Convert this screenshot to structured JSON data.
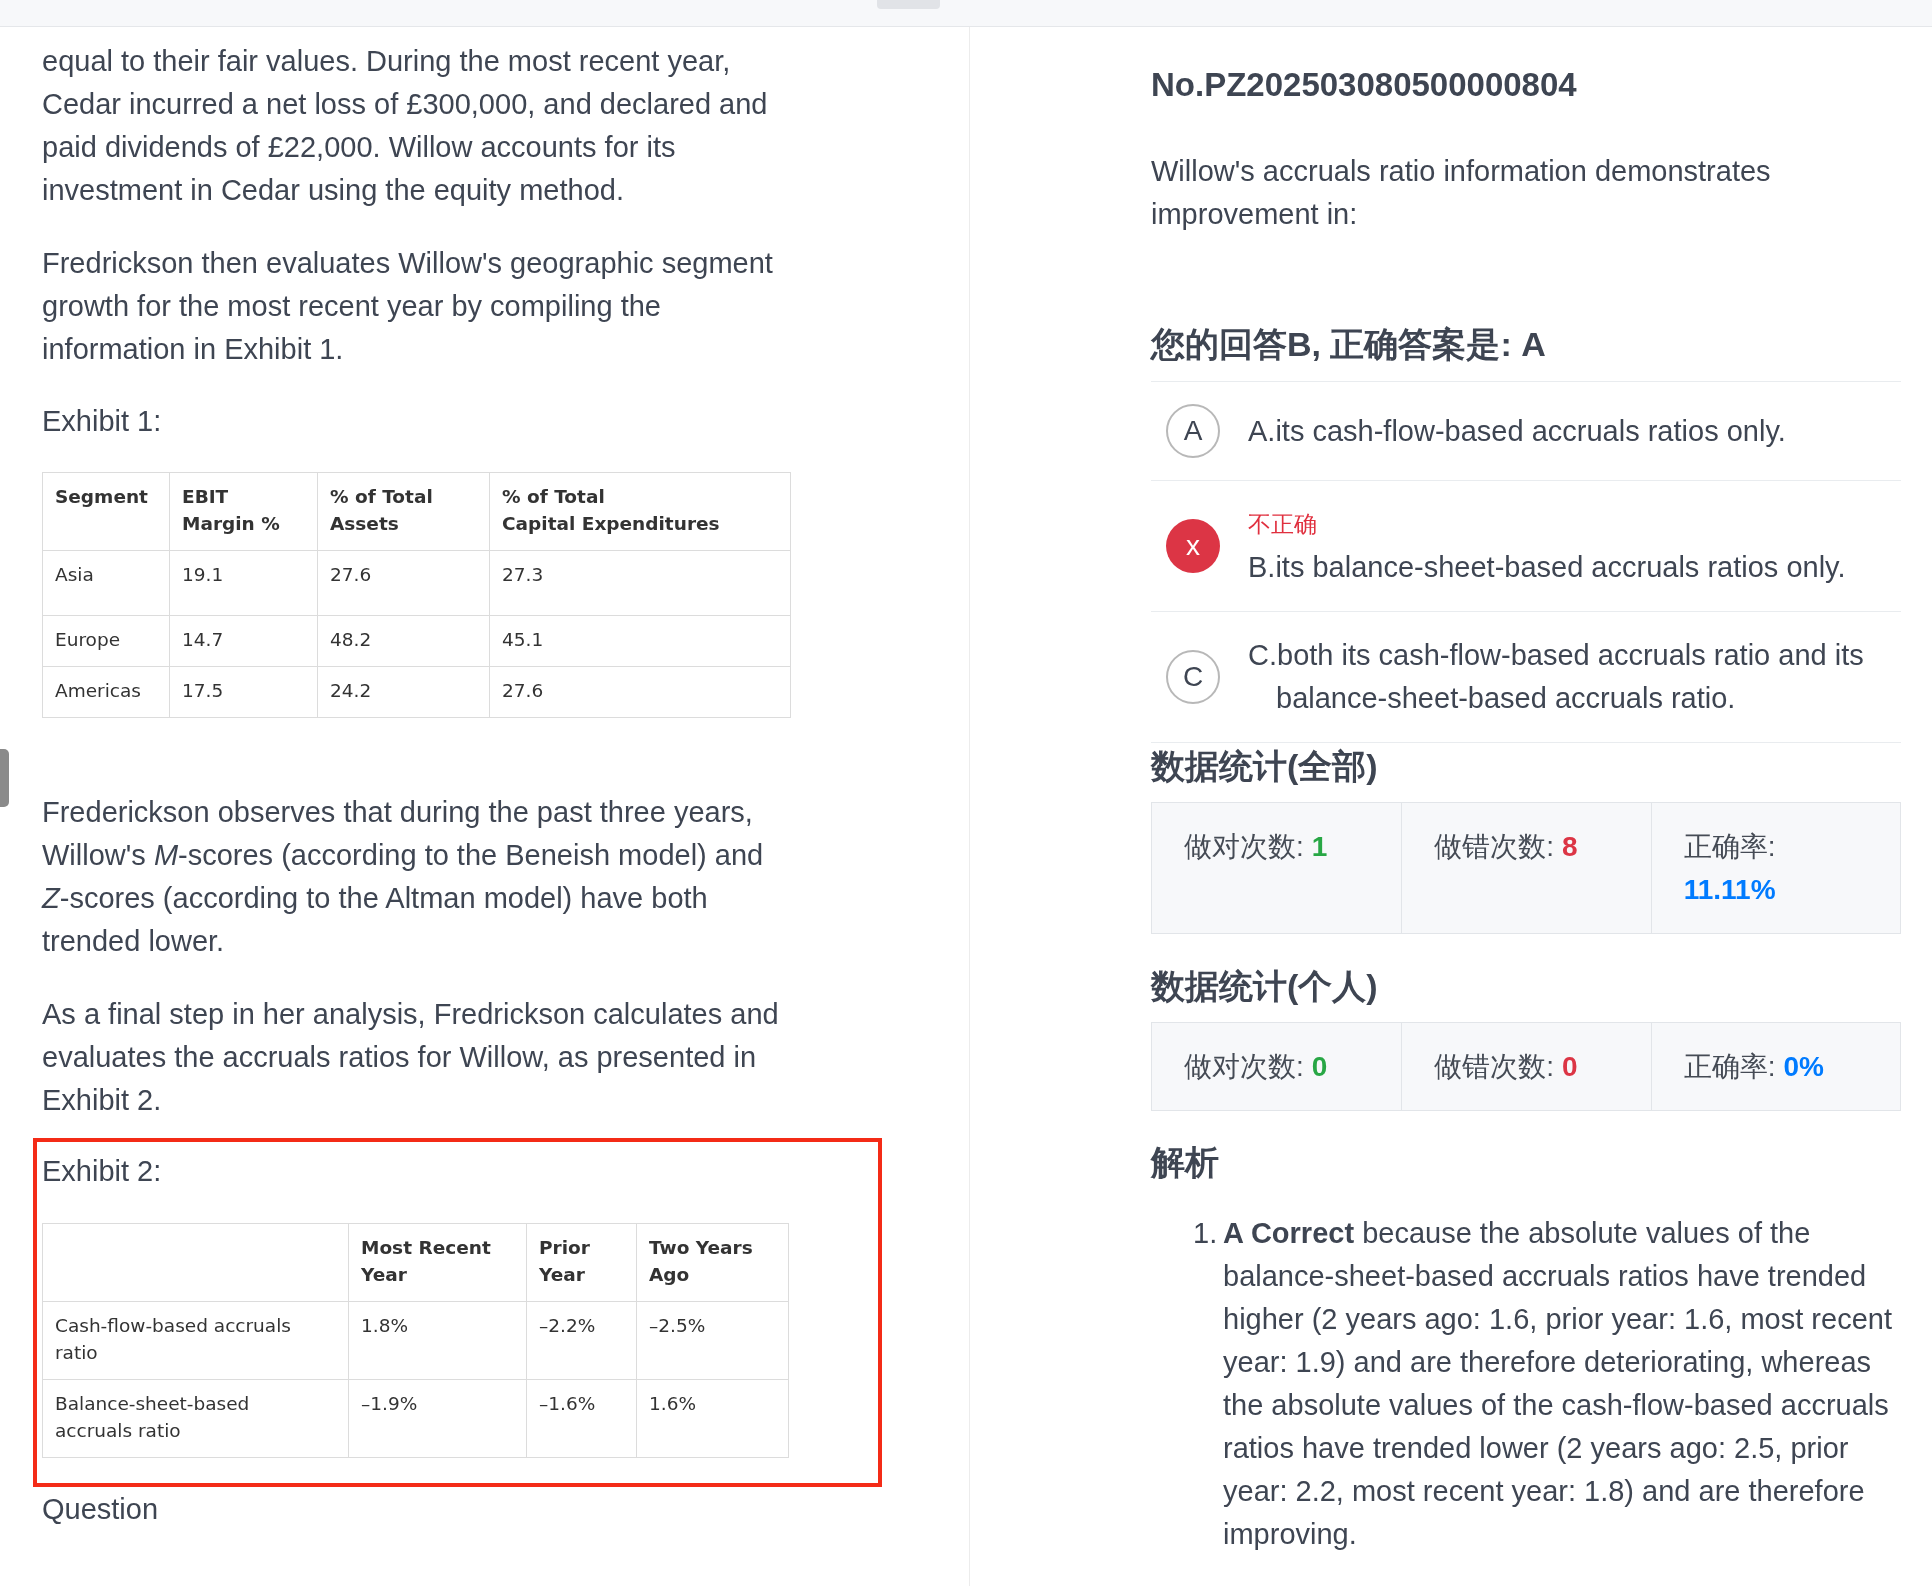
{
  "passage": {
    "blocks": [
      {
        "kind": "paragraph",
        "text": "equal to their fair values. During the most recent year, Cedar incurred a net loss of £300,000, and declared and paid dividends of £22,000. Willow accounts for its investment in Cedar using the equity method."
      },
      {
        "kind": "paragraph",
        "text": "Fredrickson then evaluates Willow's geographic segment growth for the most recent year by compiling the information in Exhibit 1."
      },
      {
        "kind": "caption",
        "text": "Exhibit 1:"
      },
      {
        "kind": "table",
        "corner": "Segment",
        "columns": [
          "EBIT\nMargin %",
          "% of Total\nAssets",
          "% of Total\nCapital Expenditures"
        ],
        "rows": [
          {
            "label": "Asia",
            "values": [
              "19.1",
              "27.6",
              "27.3"
            ]
          },
          {
            "label": "Europe",
            "values": [
              "14.7",
              "48.2",
              "45.1"
            ]
          },
          {
            "label": "Americas",
            "values": [
              "17.5",
              "24.2",
              "27.6"
            ]
          }
        ]
      },
      {
        "kind": "paragraph",
        "text": "Frederickson observes that during the past three years, Willow's *M*-scores (according to the Beneish model) and *Z*-scores (according to the Altman model) have both trended lower."
      },
      {
        "kind": "paragraph",
        "text": "As a final step in her analysis, Fredrickson calculates and evaluates the accruals ratios for Willow, as presented in Exhibit 2."
      },
      {
        "kind": "highlight",
        "blocks": [
          {
            "kind": "caption",
            "text": "Exhibit 2:"
          },
          {
            "kind": "table",
            "columns": [
              "Most Recent\nYear",
              "Prior\nYear",
              "Two Years\nAgo"
            ],
            "rows": [
              {
                "label": "Cash-flow-based accruals\nratio",
                "values": [
                  "1.8%",
                  "–2.2%",
                  "–2.5%"
                ]
              },
              {
                "label": "Balance-sheet-based\naccruals ratio",
                "values": [
                  "–1.9%",
                  "–1.6%",
                  "1.6%"
                ]
              }
            ]
          }
        ]
      },
      {
        "kind": "label",
        "text": "Question"
      }
    ]
  },
  "question": {
    "number": "No.PZ202503080500000804",
    "text": "Willow's accruals ratio information demonstrates improvement in:"
  },
  "result": {
    "heading": "您的回答B, 正确答案是: A",
    "options": [
      {
        "marker": "A",
        "text": "A.its cash-flow-based accruals ratios only.",
        "selected": false
      },
      {
        "marker": "x",
        "note": "不正确",
        "text": "B.its balance-sheet-based accruals ratios only.",
        "selected": true
      },
      {
        "marker": "C",
        "text": "C.both its cash-flow-based accruals ratio and its balance-sheet-based accruals ratio.",
        "selected": false
      }
    ]
  },
  "stats": [
    {
      "title": "数据统计(全部)",
      "cells": [
        {
          "label": "做对次数:",
          "value": "1",
          "color": "#28a745"
        },
        {
          "label": "做错次数:",
          "value": "8",
          "color": "#dc3545"
        },
        {
          "label": "正确率:",
          "value": "11.11%",
          "color": "#007bff"
        }
      ]
    },
    {
      "title": "数据统计(个人)",
      "cells": [
        {
          "label": "做对次数:",
          "value": "0",
          "color": "#28a745"
        },
        {
          "label": "做错次数:",
          "value": "0",
          "color": "#dc3545"
        },
        {
          "label": "正确率:",
          "value": "0%",
          "color": "#007bff"
        }
      ]
    }
  ],
  "analysis": {
    "title": "解析",
    "items": [
      {
        "number": "1.",
        "text": "**A Correct** because the absolute values of the balance-sheet-based accruals ratios have trended higher (2 years ago: 1.6, prior year: 1.6, most recent year: 1.9) and are therefore deteriorating, whereas the absolute values of the cash-flow-based accruals ratios have trended lower (2 years ago: 2.5, prior year: 2.2, most recent year: 1.8) and are therefore improving."
      }
    ]
  }
}
